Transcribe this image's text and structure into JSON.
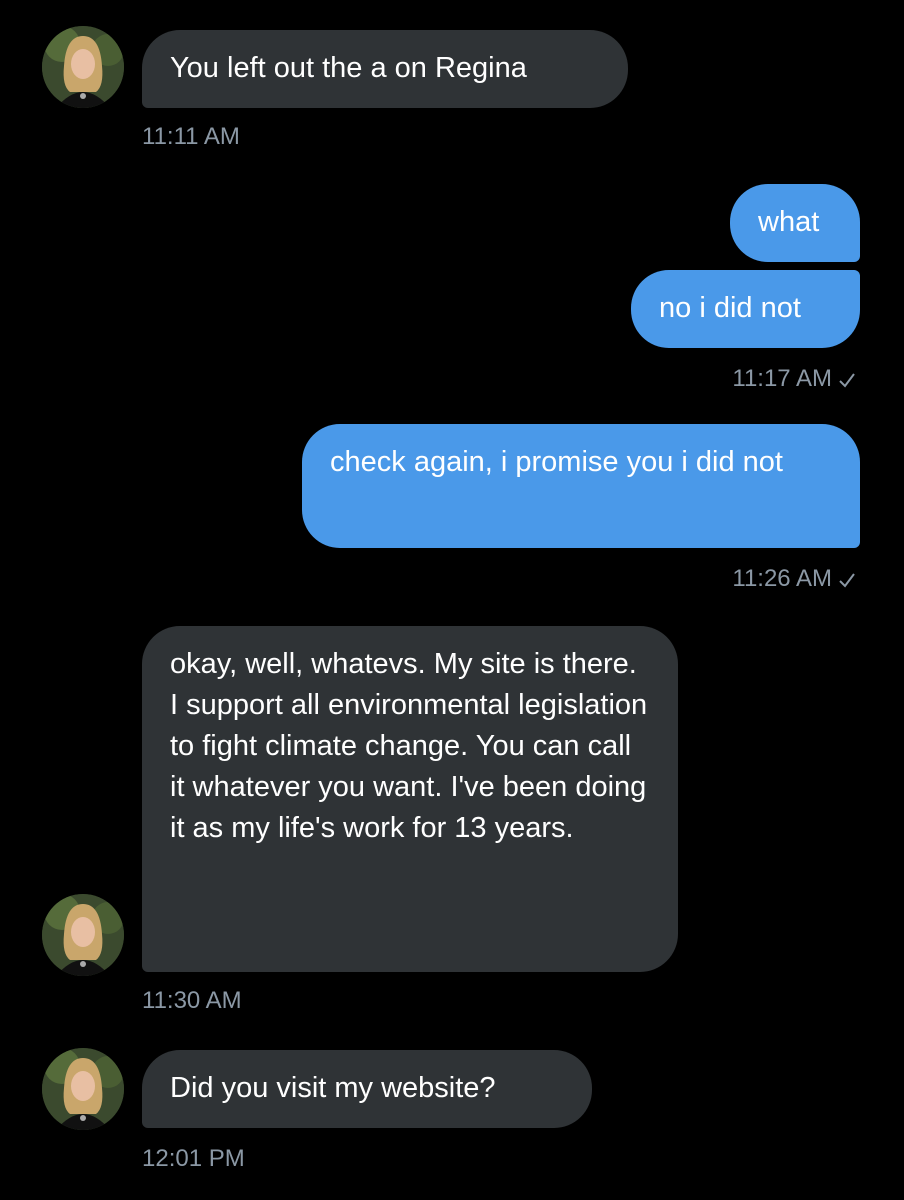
{
  "messages": [
    {
      "direction": "incoming",
      "text": "You left out the a on Regina",
      "time": "11:11 AM"
    },
    {
      "direction": "outgoing",
      "text": "what"
    },
    {
      "direction": "outgoing",
      "text": "no i did not",
      "time": "11:17 AM",
      "read_check": "checkmark-icon"
    },
    {
      "direction": "outgoing",
      "text": "check again, i promise you i did not",
      "time": "11:26 AM",
      "read_check": "checkmark-icon"
    },
    {
      "direction": "incoming",
      "text": "okay, well, whatevs. My site is there. I support all environmental legislation to fight climate change. You can call it whatever you want.  I've been doing it as my life's work for 13 years.",
      "time": "11:30 AM"
    },
    {
      "direction": "incoming",
      "text": "Did you visit my website?",
      "time": "12:01 PM"
    }
  ],
  "colors": {
    "background": "#000000",
    "incoming_bubble": "#2f3336",
    "outgoing_bubble": "#4a99e9",
    "timestamp": "#8b98a5"
  }
}
